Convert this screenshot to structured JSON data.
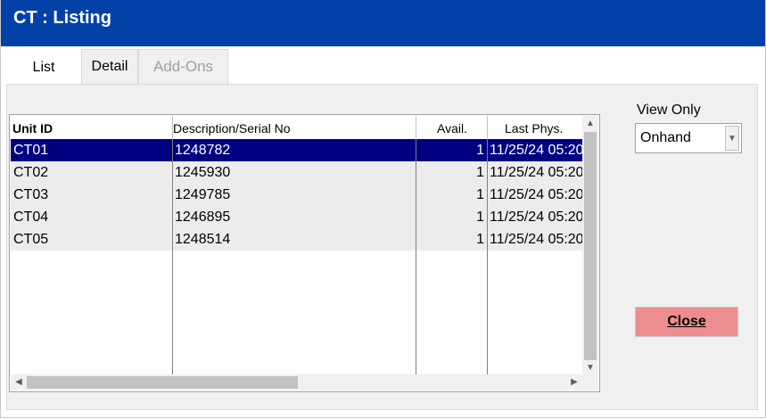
{
  "window": {
    "title": "CT : Listing"
  },
  "tabs": [
    {
      "label": "List",
      "state": "active"
    },
    {
      "label": "Detail",
      "state": "normal"
    },
    {
      "label": "Add-Ons",
      "state": "disabled"
    }
  ],
  "grid": {
    "columns": [
      "Unit ID",
      "Description/Serial No",
      "Avail.",
      "Last Phys."
    ],
    "rows": [
      {
        "unit_id": "CT01",
        "description": "1248782",
        "avail": "1",
        "last_phys": "11/25/24 05:20",
        "selected": true
      },
      {
        "unit_id": "CT02",
        "description": "1245930",
        "avail": "1",
        "last_phys": "11/25/24 05:20",
        "selected": false
      },
      {
        "unit_id": "CT03",
        "description": "1249785",
        "avail": "1",
        "last_phys": "11/25/24 05:20",
        "selected": false
      },
      {
        "unit_id": "CT04",
        "description": "1246895",
        "avail": "1",
        "last_phys": "11/25/24 05:20",
        "selected": false
      },
      {
        "unit_id": "CT05",
        "description": "1248514",
        "avail": "1",
        "last_phys": "11/25/24 05:20",
        "selected": false
      }
    ]
  },
  "view_only": {
    "label": "View Only",
    "selected": "Onhand"
  },
  "close_button": {
    "label": "Close"
  },
  "colors": {
    "titlebar": "#0141a8",
    "selection": "#000080",
    "close_button": "#ee8d8f"
  }
}
